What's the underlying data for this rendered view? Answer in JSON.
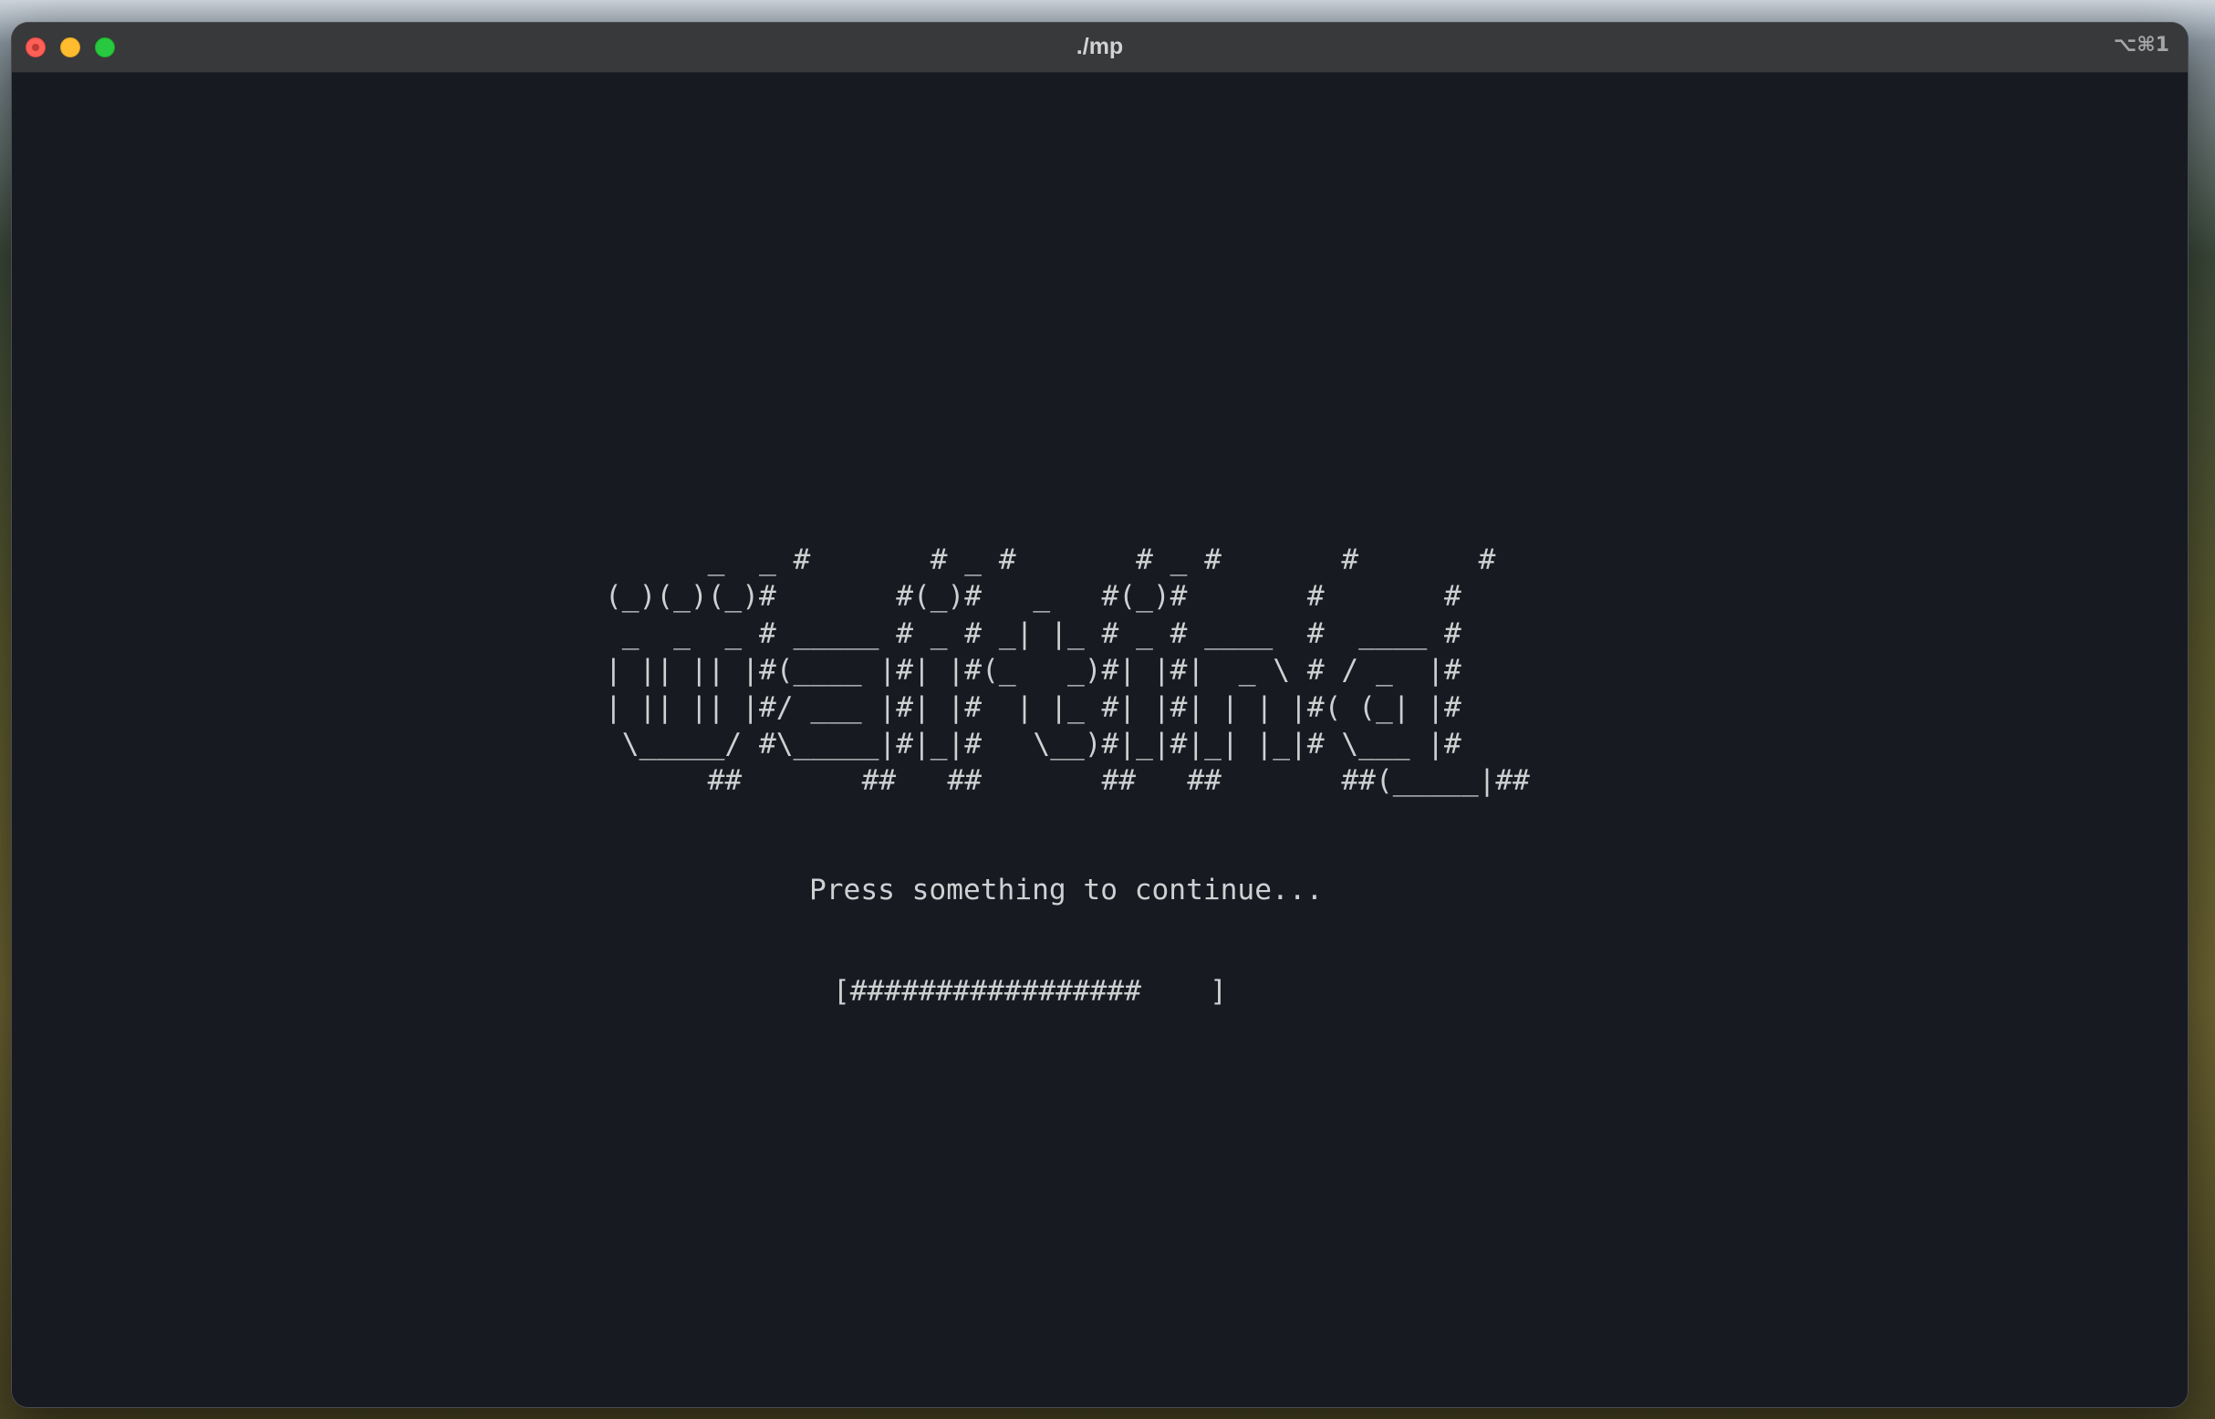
{
  "window": {
    "title": "./mp",
    "shortcut": "⌥⌘1"
  },
  "terminal": {
    "ascii_banner": "      _  _ #       # _ #       # _ #       #       #\n(_)(_)(_)#       #(_)#   _   #(_)#       #       #\n _  _  _ # _____ # _ # _| |_ # _ # ____  #  ____ #\n| || || |#(____ |#| |#(_   _)#| |#|  _ \\ # / _  |#\n| || || |#/ ___ |#| |#  | |_ #| |#| | | |#( (_| |#\n \\_____/ #\\_____|#|_|#   \\__)#|_|#|_| |_|# \\___ |#\n      ##       ##   ##       ##   ##       ##(_____|##",
    "prompt": "Press something to continue...",
    "progress_bar": "[#################    ]",
    "progress_fraction": 0.81
  },
  "colors": {
    "terminal_bg": "#171b21",
    "terminal_fg": "#cfd0d2",
    "titlebar_bg": "#38393b",
    "close": "#fe5f57",
    "minimize": "#febc2e",
    "zoom": "#28c840"
  }
}
